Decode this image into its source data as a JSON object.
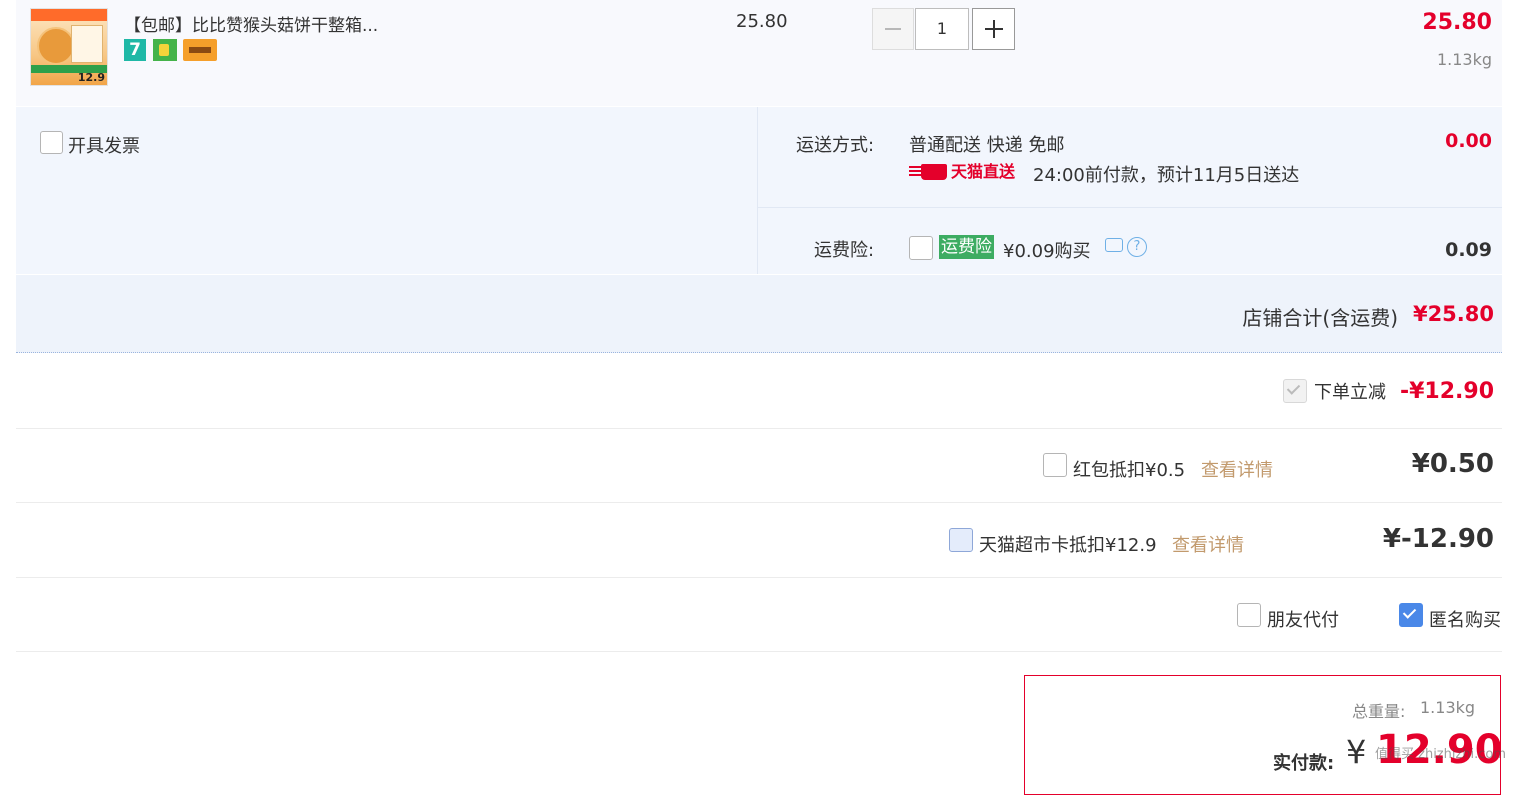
{
  "item": {
    "title": "【包邮】比比赞猴头菇饼干整箱...",
    "unit_price": "25.80",
    "quantity": "1",
    "subtotal": "25.80",
    "weight": "1.13kg",
    "thumb": {
      "price": "12.9"
    },
    "badges": [
      {
        "label": "7",
        "name": "seven-day-return-icon"
      },
      {
        "label": "",
        "name": "shopping-bag-icon"
      },
      {
        "label": "",
        "name": "credit-card-icon"
      }
    ]
  },
  "invoice": {
    "label": "开具发票"
  },
  "shipping": {
    "label": "运送方式:",
    "method": "普通配送 快递 免邮",
    "cost": "0.00",
    "brand": "天猫直送",
    "eta": "24:00前付款，预计11月5日送达"
  },
  "insurance": {
    "label": "运费险:",
    "tag": "运费险",
    "price_text": "¥0.09购买",
    "value": "0.09"
  },
  "store_total": {
    "label": "店铺合计(含运费)",
    "value": "¥25.80"
  },
  "discounts": [
    {
      "label": "下单立减",
      "value": "-¥12.90"
    },
    {
      "label": "红包抵扣¥0.5",
      "link": "查看详情",
      "value": "¥0.50"
    },
    {
      "label": "天猫超市卡抵扣¥12.9",
      "link": "查看详情",
      "value": "¥-12.90"
    }
  ],
  "options": {
    "friend_pay": "朋友代付",
    "anonymous": "匿名购买"
  },
  "summary": {
    "total_label": "总重量:",
    "total_value": "1.13kg",
    "pay_label": "实付款:",
    "currency": "¥",
    "amount": "12.90"
  },
  "watermark": "值得买 zhizhizhi.com",
  "colors": {
    "accent": "#e4002b",
    "link": "#c29a6d",
    "checkbox_active": "#4a88e8",
    "tag_green": "#3dac62"
  }
}
